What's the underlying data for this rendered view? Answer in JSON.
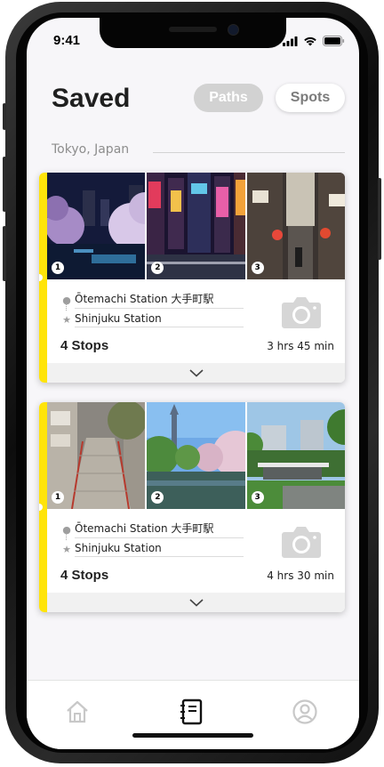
{
  "status_bar": {
    "time": "9:41"
  },
  "header": {
    "title": "Saved"
  },
  "segments": [
    {
      "label": "Paths",
      "selected": true
    },
    {
      "label": "Spots",
      "selected": false
    }
  ],
  "section": {
    "location": "Tokyo, Japan"
  },
  "cards": [
    {
      "photos": [
        {
          "number": "1"
        },
        {
          "number": "2"
        },
        {
          "number": "3"
        }
      ],
      "start": "Ōtemachi Station 大手町駅",
      "end": "Shinjuku Station",
      "stops": "4 Stops",
      "duration": "3 hrs 45 min"
    },
    {
      "photos": [
        {
          "number": "1"
        },
        {
          "number": "2"
        },
        {
          "number": "3"
        }
      ],
      "start": "Ōtemachi Station 大手町駅",
      "end": "Shinjuku Station",
      "stops": "4 Stops",
      "duration": "4 hrs 30 min"
    }
  ],
  "tabbar": {
    "items": [
      "home-icon",
      "notebook-icon",
      "profile-icon"
    ],
    "active": "notebook-icon"
  },
  "colors": {
    "accent": "#ffe40a",
    "background": "#f7f6f9"
  }
}
